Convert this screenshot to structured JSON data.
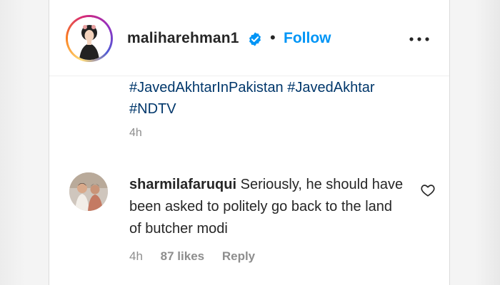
{
  "post": {
    "username": "maliharehman1",
    "separator": "•",
    "follow_label": "Follow",
    "verified_icon": "verified-badge-icon",
    "more_icon": "more-options-icon",
    "hashtags": [
      "#JavedAkhtarInPakistan",
      "#JavedAkhtar",
      "#NDTV"
    ],
    "time": "4h"
  },
  "comment": {
    "username": "sharmilafaruqui",
    "text": "Seriously, he should have been asked to politely go back to the land of butcher modi",
    "time": "4h",
    "likes": "87 likes",
    "reply_label": "Reply",
    "like_icon": "heart-icon"
  },
  "colors": {
    "link_blue": "#0095f6",
    "hashtag_blue": "#00376b",
    "muted_gray": "#8e8e8e",
    "text_dark": "#262626"
  }
}
